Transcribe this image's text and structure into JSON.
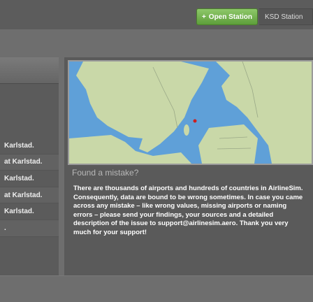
{
  "toolbar": {
    "open_station_label": "Open Station",
    "open_station_icon": "plus-icon",
    "ksd_station_label": "KSD Station"
  },
  "left_list": {
    "items": [
      "Karlstad.",
      "at Karlstad.",
      "Karlstad.",
      "at Karlstad.",
      "Karlstad.",
      "."
    ]
  },
  "map": {
    "land_color": "#c9d8a8",
    "water_color": "#5fa0d8",
    "marker_color": "#cc1f1f"
  },
  "mistake": {
    "title": "Found a mistake?",
    "body_before": "There are thousands of airports and hundreds of countries in AirlineSim. Consequently, data are bound to be wrong sometimes. In case you came across any mistake – like wrong values, missing airports or naming errors – please send your findings, your sources and a detailed description of the issue to ",
    "email": "support@airlinesim.aero",
    "body_after": ". Thank you very much for your support!"
  }
}
